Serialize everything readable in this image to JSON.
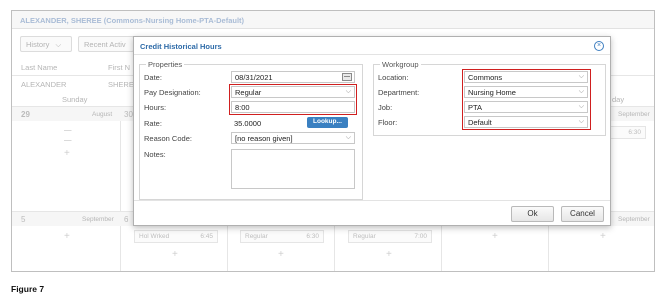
{
  "background": {
    "title": "ALEXANDER, SHEREE (Commons-Nursing Home-PTA-Default)",
    "toolbar": {
      "history": "History",
      "recent": "Recent Activ"
    },
    "columns": {
      "last_name": "Last Name",
      "first_name": "First N"
    },
    "values": {
      "last_name": "ALEXANDER",
      "first_name": "SHERE"
    },
    "day_headers": {
      "sunday": "Sunday",
      "saturday": "day"
    },
    "week1": {
      "day29": "29",
      "august": "August",
      "day30": "30",
      "september": "September",
      "shift_time": "6:30"
    },
    "week2": {
      "day5": "5",
      "september": "September",
      "day6": "6",
      "september_right": "September"
    },
    "shifts": [
      {
        "name": "Hol Wrked",
        "time": "6:45"
      },
      {
        "name": "Regular",
        "time": "6:30"
      },
      {
        "name": "Regular",
        "time": "7:00"
      }
    ]
  },
  "dialog": {
    "title": "Credit Historical Hours",
    "close_icon": "close-circle-icon",
    "properties": {
      "legend": "Properties",
      "date_label": "Date:",
      "date_value": "08/31/2021",
      "pay_label": "Pay Designation:",
      "pay_value": "Regular",
      "hours_label": "Hours:",
      "hours_value": "8:00",
      "rate_label": "Rate:",
      "rate_value": "35.0000",
      "lookup_label": "Lookup...",
      "reason_label": "Reason Code:",
      "reason_value": "[no reason given]",
      "notes_label": "Notes:",
      "notes_value": ""
    },
    "workgroup": {
      "legend": "Workgroup",
      "location_label": "Location:",
      "location_value": "Commons",
      "department_label": "Department:",
      "department_value": "Nursing Home",
      "job_label": "Job:",
      "job_value": "PTA",
      "floor_label": "Floor:",
      "floor_value": "Default"
    },
    "ok_label": "Ok",
    "cancel_label": "Cancel"
  },
  "colors": {
    "accent": "#3a80c1",
    "highlight": "#d01f1f",
    "title": "#2e6ba8"
  },
  "caption": "Figure 7"
}
